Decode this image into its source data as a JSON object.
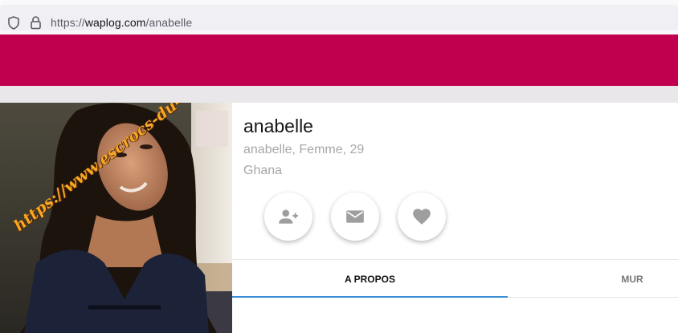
{
  "browser": {
    "url_scheme": "https://",
    "url_host": "waplog.com",
    "url_path": "/anabelle"
  },
  "theme": {
    "header_color": "#c0004e",
    "tab_indicator_color": "#3a8fd6"
  },
  "profile": {
    "name": "anabelle",
    "details": "anabelle, Femme, 29",
    "country": "Ghana",
    "photo_watermark": "https://www.escrocs-du-web.fr"
  },
  "actions": [
    {
      "icon": "add-friend-icon"
    },
    {
      "icon": "message-icon"
    },
    {
      "icon": "heart-icon"
    }
  ],
  "tabs": {
    "about": "A PROPOS",
    "wall": "MUR",
    "active": "about"
  }
}
